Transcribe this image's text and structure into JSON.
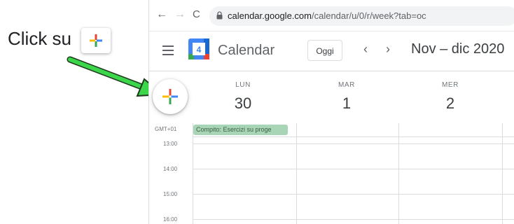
{
  "instruction": {
    "text": "Click su"
  },
  "browser": {
    "url_host": "calendar.google.com",
    "url_path": "/calendar/u/0/r/week?tab=oc"
  },
  "app": {
    "title": "Calendar",
    "logo_number": "4",
    "today_label": "Oggi",
    "prev_icon": "chevron-left-icon",
    "next_icon": "chevron-right-icon",
    "date_range": "Nov – dic 2020"
  },
  "days": [
    {
      "name": "LUN",
      "num": "30"
    },
    {
      "name": "MAR",
      "num": "1"
    },
    {
      "name": "MER",
      "num": "2"
    }
  ],
  "timezone": "GMT+01",
  "event": {
    "title": "Compito: Esercizi su proge"
  },
  "hours": [
    "13:00",
    "14:00",
    "15:00",
    "16:00"
  ],
  "colors": {
    "google_blue": "#4285f4",
    "google_red": "#ea4335",
    "google_yellow": "#fbbc04",
    "google_green": "#34a853",
    "event_bg": "#a8d5b5",
    "arrow": "#3cd64a"
  }
}
